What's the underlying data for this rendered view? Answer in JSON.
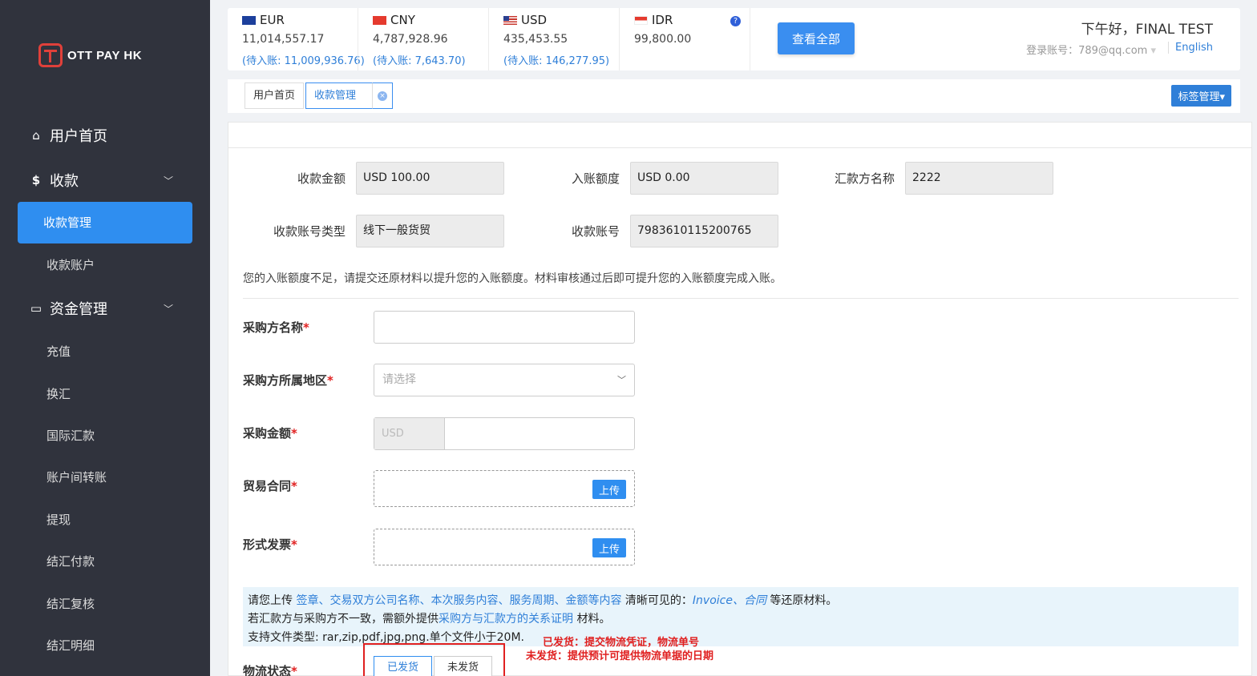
{
  "brand": {
    "name": "OTT PAY HK"
  },
  "sidebar": {
    "home": "用户首页",
    "collection": "收款",
    "collection_active": "收款管理",
    "collection_account": "收款账户",
    "funds": "资金管理",
    "sub_items": [
      "充值",
      "换汇",
      "国际汇款",
      "账户间转账",
      "提现",
      "结汇付款",
      "结汇复核",
      "结汇明细"
    ]
  },
  "balances": [
    {
      "code": "EUR",
      "amount": "11,014,557.17",
      "pending": "(待入账: 11,009,936.76)"
    },
    {
      "code": "CNY",
      "amount": "4,787,928.96",
      "pending": "(待入账: 7,643.70)"
    },
    {
      "code": "USD",
      "amount": "435,453.55",
      "pending": "(待入账: 146,277.95)"
    },
    {
      "code": "IDR",
      "amount": "99,800.00",
      "pending": ""
    }
  ],
  "header": {
    "help": "?",
    "view_all": "查看全部",
    "greeting": "下午好，FINAL TEST",
    "login_account": "登录账号：789@qq.com",
    "language": "English"
  },
  "tabs": {
    "home": "用户首页",
    "active": "收款管理",
    "close": "×",
    "tag_manage": "标签管理▾"
  },
  "detail": {
    "amount_label": "收款金额",
    "amount_value": "USD 100.00",
    "credited_label": "入账额度",
    "credited_value": "USD 0.00",
    "payer_label": "汇款方名称",
    "payer_value": "2222",
    "type_label": "收款账号类型",
    "type_value": "线下一般货贸",
    "account_label": "收款账号",
    "account_value": "7983610115200765"
  },
  "notice": "您的入账额度不足，请提交还原材料以提升您的入账额度。材料审核通过后即可提升您的入账额度完成入账。",
  "form": {
    "buyer_name": "采购方名称",
    "buyer_region": "采购方所属地区",
    "region_placeholder": "请选择",
    "purchase_amount": "采购金额",
    "currency_prefix": "USD",
    "contract": "贸易合同",
    "invoice": "形式发票",
    "upload": "上传",
    "logistics": "物流状态",
    "required": "*",
    "shipped": "已发货",
    "not_shipped": "未发货"
  },
  "info": {
    "l1_a": "请您上传 ",
    "l1_b": "签章、交易双方公司名称、本次服务内容、服务周期、金额等内容",
    "l1_c": " 清晰可见的：",
    "l1_d": "Invoice、合同",
    "l1_e": " 等还原材料。",
    "l2_a": "若汇款方与采购方不一致，需额外提供",
    "l2_b": "采购方与汇款方的关系证明",
    "l2_c": " 材料。",
    "l3": "支持文件类型: rar,zip,pdf,jpg,png.单个文件小于20M."
  },
  "annotations": {
    "shipped_note": "已发货：提交物流凭证，物流单号",
    "not_shipped_note": "未发货：提供预计可提供物流单据的日期"
  }
}
